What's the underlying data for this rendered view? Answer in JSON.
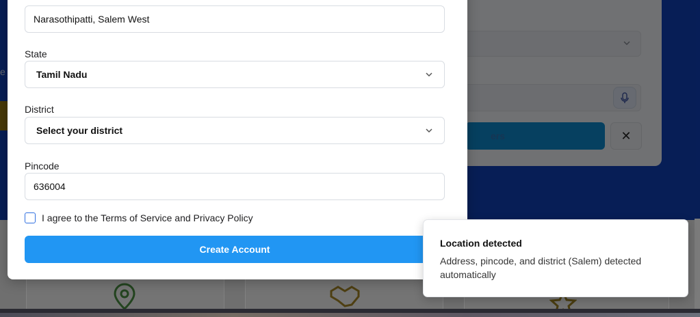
{
  "background": {
    "left_partial_text": "e",
    "cta_partial_label": "ers",
    "close_glyph": "✕",
    "icons": [
      "map-pin-icon",
      "handshake-icon",
      "star-icon"
    ],
    "colors": {
      "hero": "#0e3aa6",
      "cta": "#0d7cb8"
    }
  },
  "form": {
    "address_value": "Narasothipatti, Salem West",
    "state": {
      "label": "State",
      "value": "Tamil Nadu"
    },
    "district": {
      "label": "District",
      "value": "Select your district"
    },
    "pincode": {
      "label": "Pincode",
      "value": "636004"
    },
    "terms_label": "I agree to the Terms of Service and Privacy Policy",
    "terms_checked": false,
    "submit_label": "Create Account",
    "colors": {
      "primary": "#2196f3",
      "checkbox_border": "#2f6fe0"
    }
  },
  "toast": {
    "title": "Location detected",
    "message": "Address, pincode, and district (Salem) detected automatically"
  }
}
